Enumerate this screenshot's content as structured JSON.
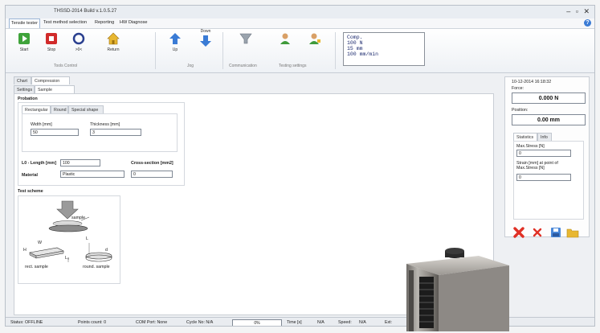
{
  "window": {
    "title": "THSSD-2014 Build v.1.0.5.27",
    "controls": "– ▫ ✕"
  },
  "menu": {
    "items": [
      "Tensile tester",
      "Test method selection",
      "Reporting",
      "HW Diagnose"
    ],
    "help": "?"
  },
  "ribbon": {
    "buttons": {
      "start": "Start",
      "stop": "Stop",
      "zero": ">0<",
      "return": "Return",
      "up": "Up",
      "down": "Down",
      "down_label": "Jog"
    },
    "groups": {
      "tools_control": "Tools Control",
      "jog": "Jog",
      "communication": "Communication",
      "testing_settings": "Testing settings"
    },
    "display_lines": [
      "Comp.",
      "100 N",
      "15 mm",
      "100 mm/min"
    ]
  },
  "tabs": {
    "main": [
      "Chart",
      "Compression Test"
    ],
    "sub": [
      "Settings",
      "Sample Description"
    ],
    "shape": [
      "Rectangular",
      "Round",
      "Special shape"
    ]
  },
  "form": {
    "probation_title": "Probation",
    "width_label": "Width [mm]",
    "width_value": "50",
    "thickness_label": "Thickness [mm]",
    "thickness_value": "3",
    "length_label": "L0 - Length [mm]",
    "length_value": "100",
    "cross_label": "Cross-section [mm2]",
    "cross_value": "0",
    "material_label": "Material",
    "material_value": "Plastic",
    "scheme_title": "Test scheme",
    "scheme_sample": "sample",
    "scheme_rect": "rect. sample",
    "scheme_round": "round. sample",
    "scheme_w": "W",
    "scheme_h": "H",
    "scheme_l0": "L₀",
    "scheme_l": "L",
    "scheme_d": "d"
  },
  "right": {
    "datetime": "10-12-2014 16:18:32",
    "force_label": "Force:",
    "force_value": "0.000 N",
    "position_label": "Position:",
    "position_value": "0.00 mm",
    "tabs": [
      "Statistics",
      "Info"
    ],
    "max_stress_label": "Max.Stress [N]",
    "max_stress_value": "0",
    "strain_label": "Strain [mm] at point of Max.Stress [N]",
    "strain_value": "0"
  },
  "status": {
    "status": "Status: OFFLINE",
    "points": "Points count: 0",
    "com": "COM Port: None",
    "cycle": "Cycle No: N/A",
    "progress": "0%",
    "time_label": "Time [s]",
    "time_value": "N/A",
    "speed_label": "Speed:",
    "speed_value": "N/A",
    "ext": "Ext:"
  },
  "colors": {
    "accent": "#3a7bd5",
    "start": "#3fa33a",
    "stop": "#d12b2b",
    "delete": "#e03025",
    "save": "#4a88d8",
    "folder": "#e8b731"
  }
}
